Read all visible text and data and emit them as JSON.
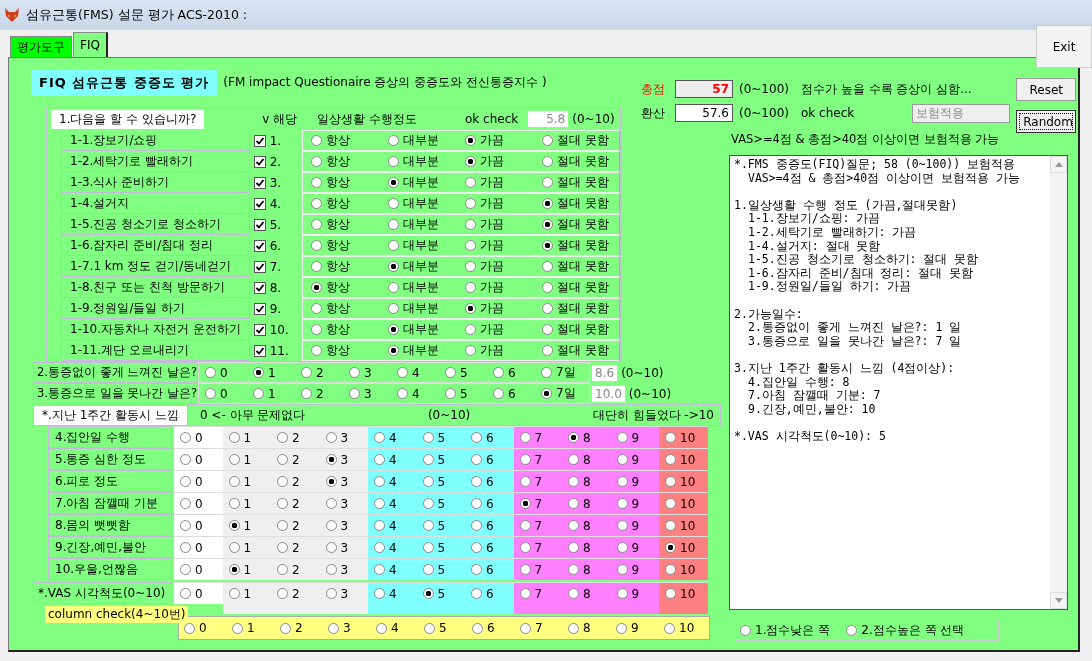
{
  "window": {
    "title": "섬유근통(FMS) 설문 평가 ACS-2010 :"
  },
  "tabs": [
    {
      "label": "평가도구",
      "selected": false
    },
    {
      "label": "FIQ",
      "selected": true
    }
  ],
  "exit_button": "Exit",
  "heading": {
    "title": "FIQ 섬유근통 중증도 평가",
    "subtitle": "(FM impact Questionaire 증상의 중증도와 전신통증지수 )"
  },
  "daily": {
    "title": "1.다음을 할 수 있습니까?",
    "check_header": "v 해당",
    "scale_header": "일상생활 수행정도",
    "ok_label": "ok check",
    "ok_value": "5.8",
    "range": "(0~10)",
    "items": [
      {
        "label": "1-1.장보기/쇼핑",
        "checked": true,
        "number": "1.",
        "options": [
          {
            "label": "항상",
            "selected": false
          },
          {
            "label": "대부분",
            "selected": false
          },
          {
            "label": "가끔",
            "selected": true
          },
          {
            "label": "절대 못함",
            "selected": false
          }
        ]
      },
      {
        "label": "1-2.세탁기로 빨래하기",
        "checked": true,
        "number": "2.",
        "options": [
          {
            "label": "항상",
            "selected": false
          },
          {
            "label": "대부분",
            "selected": false
          },
          {
            "label": "가끔",
            "selected": true
          },
          {
            "label": "절대 못함",
            "selected": false
          }
        ]
      },
      {
        "label": "1-3.식사 준비하기",
        "checked": true,
        "number": "3.",
        "options": [
          {
            "label": "항상",
            "selected": false
          },
          {
            "label": "대부분",
            "selected": true
          },
          {
            "label": "가끔",
            "selected": false
          },
          {
            "label": "절대 못함",
            "selected": false
          }
        ]
      },
      {
        "label": "1-4.설거지",
        "checked": true,
        "number": "4.",
        "options": [
          {
            "label": "항상",
            "selected": false
          },
          {
            "label": "대부분",
            "selected": false
          },
          {
            "label": "가끔",
            "selected": false
          },
          {
            "label": "절대 못함",
            "selected": true
          }
        ]
      },
      {
        "label": "1-5.진공 청소기로 청소하기",
        "checked": true,
        "number": "5.",
        "options": [
          {
            "label": "항상",
            "selected": false
          },
          {
            "label": "대부분",
            "selected": false
          },
          {
            "label": "가끔",
            "selected": false
          },
          {
            "label": "절대 못함",
            "selected": true
          }
        ]
      },
      {
        "label": "1-6.잠자리 준비/침대 정리",
        "checked": true,
        "number": "6.",
        "options": [
          {
            "label": "항상",
            "selected": false
          },
          {
            "label": "대부분",
            "selected": false
          },
          {
            "label": "가끔",
            "selected": false
          },
          {
            "label": "절대 못함",
            "selected": true
          }
        ]
      },
      {
        "label": "1-7.1 km 정도 걷기/동네걷기",
        "checked": true,
        "number": "7.",
        "options": [
          {
            "label": "항상",
            "selected": false
          },
          {
            "label": "대부분",
            "selected": true
          },
          {
            "label": "가끔",
            "selected": false
          },
          {
            "label": "절대 못함",
            "selected": false
          }
        ]
      },
      {
        "label": "1-8.친구 또는 친척 방문하기",
        "checked": true,
        "number": "8.",
        "options": [
          {
            "label": "항상",
            "selected": true
          },
          {
            "label": "대부분",
            "selected": false
          },
          {
            "label": "가끔",
            "selected": false
          },
          {
            "label": "절대 못함",
            "selected": false
          }
        ]
      },
      {
        "label": "1-9.정원일/들일 하기",
        "checked": true,
        "number": "9.",
        "options": [
          {
            "label": "항상",
            "selected": false
          },
          {
            "label": "대부분",
            "selected": false
          },
          {
            "label": "가끔",
            "selected": true
          },
          {
            "label": "절대 못함",
            "selected": false
          }
        ]
      },
      {
        "label": "1-10.자동차나 자전거 운전하기",
        "checked": true,
        "number": "10.",
        "options": [
          {
            "label": "항상",
            "selected": false
          },
          {
            "label": "대부분",
            "selected": true
          },
          {
            "label": "가끔",
            "selected": false
          },
          {
            "label": "절대 못함",
            "selected": false
          }
        ]
      },
      {
        "label": "1-11.계단 오르내리기",
        "checked": true,
        "number": "11.",
        "options": [
          {
            "label": "항상",
            "selected": false
          },
          {
            "label": "대부분",
            "selected": true
          },
          {
            "label": "가끔",
            "selected": false
          },
          {
            "label": "절대 못함",
            "selected": false
          }
        ]
      }
    ]
  },
  "days": [
    {
      "label": "2.통증없이 좋게 느껴진 날은?",
      "value": "8.6",
      "range": "(0~10)",
      "options": [
        {
          "label": "0",
          "selected": false
        },
        {
          "label": "1",
          "selected": true
        },
        {
          "label": "2",
          "selected": false
        },
        {
          "label": "3",
          "selected": false
        },
        {
          "label": "4",
          "selected": false
        },
        {
          "label": "5",
          "selected": false
        },
        {
          "label": "6",
          "selected": false
        },
        {
          "label": "7일",
          "selected": false
        }
      ]
    },
    {
      "label": "3.통증으로 일을 못나간 날은?",
      "value": "10.0",
      "range": "(0~10)",
      "options": [
        {
          "label": "0",
          "selected": false
        },
        {
          "label": "1",
          "selected": false
        },
        {
          "label": "2",
          "selected": false
        },
        {
          "label": "3",
          "selected": false
        },
        {
          "label": "4",
          "selected": false
        },
        {
          "label": "5",
          "selected": false
        },
        {
          "label": "6",
          "selected": false
        },
        {
          "label": "7일",
          "selected": true
        }
      ]
    }
  ],
  "feelings": {
    "title": "*.지난 1주간 활동시 느낌",
    "low_label": "0 <- 아무 문제없다",
    "range": "(0~10)",
    "high_label": "대단히 힘들었다 ->10",
    "rows": [
      {
        "label": "4.집안일 수행",
        "options": [
          {
            "label": "0",
            "selected": false
          },
          {
            "label": "1",
            "selected": false
          },
          {
            "label": "2",
            "selected": false
          },
          {
            "label": "3",
            "selected": false
          },
          {
            "label": "4",
            "selected": false
          },
          {
            "label": "5",
            "selected": false
          },
          {
            "label": "6",
            "selected": false
          },
          {
            "label": "7",
            "selected": false
          },
          {
            "label": "8",
            "selected": true
          },
          {
            "label": "9",
            "selected": false
          },
          {
            "label": "10",
            "selected": false
          }
        ]
      },
      {
        "label": "5.통증 심한 정도",
        "options": [
          {
            "label": "0",
            "selected": false
          },
          {
            "label": "1",
            "selected": false
          },
          {
            "label": "2",
            "selected": false
          },
          {
            "label": "3",
            "selected": true
          },
          {
            "label": "4",
            "selected": false
          },
          {
            "label": "5",
            "selected": false
          },
          {
            "label": "6",
            "selected": false
          },
          {
            "label": "7",
            "selected": false
          },
          {
            "label": "8",
            "selected": false
          },
          {
            "label": "9",
            "selected": false
          },
          {
            "label": "10",
            "selected": false
          }
        ]
      },
      {
        "label": "6.피로 정도",
        "options": [
          {
            "label": "0",
            "selected": false
          },
          {
            "label": "1",
            "selected": false
          },
          {
            "label": "2",
            "selected": false
          },
          {
            "label": "3",
            "selected": true
          },
          {
            "label": "4",
            "selected": false
          },
          {
            "label": "5",
            "selected": false
          },
          {
            "label": "6",
            "selected": false
          },
          {
            "label": "7",
            "selected": false
          },
          {
            "label": "8",
            "selected": false
          },
          {
            "label": "9",
            "selected": false
          },
          {
            "label": "10",
            "selected": false
          }
        ]
      },
      {
        "label": "7.아침 잠깰때 기분",
        "options": [
          {
            "label": "0",
            "selected": false
          },
          {
            "label": "1",
            "selected": false
          },
          {
            "label": "2",
            "selected": false
          },
          {
            "label": "3",
            "selected": false
          },
          {
            "label": "4",
            "selected": false
          },
          {
            "label": "5",
            "selected": false
          },
          {
            "label": "6",
            "selected": false
          },
          {
            "label": "7",
            "selected": true
          },
          {
            "label": "8",
            "selected": false
          },
          {
            "label": "9",
            "selected": false
          },
          {
            "label": "10",
            "selected": false
          }
        ]
      },
      {
        "label": "8.몸의 뻣뻣함",
        "options": [
          {
            "label": "0",
            "selected": false
          },
          {
            "label": "1",
            "selected": true
          },
          {
            "label": "2",
            "selected": false
          },
          {
            "label": "3",
            "selected": false
          },
          {
            "label": "4",
            "selected": false
          },
          {
            "label": "5",
            "selected": false
          },
          {
            "label": "6",
            "selected": false
          },
          {
            "label": "7",
            "selected": false
          },
          {
            "label": "8",
            "selected": false
          },
          {
            "label": "9",
            "selected": false
          },
          {
            "label": "10",
            "selected": false
          }
        ]
      },
      {
        "label": "9.긴장,예민,불안",
        "options": [
          {
            "label": "0",
            "selected": false
          },
          {
            "label": "1",
            "selected": false
          },
          {
            "label": "2",
            "selected": false
          },
          {
            "label": "3",
            "selected": false
          },
          {
            "label": "4",
            "selected": false
          },
          {
            "label": "5",
            "selected": false
          },
          {
            "label": "6",
            "selected": false
          },
          {
            "label": "7",
            "selected": false
          },
          {
            "label": "8",
            "selected": false
          },
          {
            "label": "9",
            "selected": false
          },
          {
            "label": "10",
            "selected": true
          }
        ]
      },
      {
        "label": "10.우울,언짢음",
        "options": [
          {
            "label": "0",
            "selected": false
          },
          {
            "label": "1",
            "selected": true
          },
          {
            "label": "2",
            "selected": false
          },
          {
            "label": "3",
            "selected": false
          },
          {
            "label": "4",
            "selected": false
          },
          {
            "label": "5",
            "selected": false
          },
          {
            "label": "6",
            "selected": false
          },
          {
            "label": "7",
            "selected": false
          },
          {
            "label": "8",
            "selected": false
          },
          {
            "label": "9",
            "selected": false
          },
          {
            "label": "10",
            "selected": false
          }
        ]
      }
    ]
  },
  "vas": {
    "label": "*.VAS 시각척도(0~10)",
    "options": [
      {
        "label": "0",
        "selected": false
      },
      {
        "label": "1",
        "selected": false
      },
      {
        "label": "2",
        "selected": false
      },
      {
        "label": "3",
        "selected": false
      },
      {
        "label": "4",
        "selected": false
      },
      {
        "label": "5",
        "selected": true
      },
      {
        "label": "6",
        "selected": false
      },
      {
        "label": "7",
        "selected": false
      },
      {
        "label": "8",
        "selected": false
      },
      {
        "label": "9",
        "selected": false
      },
      {
        "label": "10",
        "selected": false
      }
    ]
  },
  "column_check": {
    "label": "column check(4~10번)",
    "options": [
      {
        "label": "0",
        "selected": false
      },
      {
        "label": "1",
        "selected": false
      },
      {
        "label": "2",
        "selected": false
      },
      {
        "label": "3",
        "selected": false
      },
      {
        "label": "4",
        "selected": false
      },
      {
        "label": "5",
        "selected": false
      },
      {
        "label": "6",
        "selected": false
      },
      {
        "label": "7",
        "selected": false
      },
      {
        "label": "8",
        "selected": false
      },
      {
        "label": "9",
        "selected": false
      },
      {
        "label": "10",
        "selected": false
      }
    ]
  },
  "scores": {
    "total": {
      "label": "총점",
      "value": "57",
      "range": "(0~100)",
      "note": "점수가 높을 수록 증상이 심함..."
    },
    "converted": {
      "label": "환산",
      "value": "57.6",
      "range": "(0~100)",
      "ok_label": "ok check",
      "status": "보험적용"
    },
    "rule": "VAS>=4점 & 총점>40점 이상이면 보험적용 가능"
  },
  "buttons": [
    {
      "label": "Reset",
      "focused": false
    },
    {
      "label": "Random",
      "focused": true
    }
  ],
  "report": [
    {
      "title": "*.FMS 중증도(FIQ)질문; 58 (0~100)) 보험적용",
      "lines": [
        "VAS>=4점 & 총점>40점 이상이면 보험적용 가능"
      ]
    },
    {
      "title": "1.일상생활 수행 정도 (가끔,절대못함)",
      "lines": [
        "1-1.장보기/쇼핑: 가끔",
        "1-2.세탁기로 빨래하기: 가끔",
        "1-4.설거지: 절대 못함",
        "1-5.진공 청소기로 청소하기: 절대 못함",
        "1-6.잠자리 준비/침대 정리: 절대 못함",
        "1-9.정원일/들일 하기: 가끔"
      ]
    },
    {
      "title": "2.가능일수:",
      "lines": [
        "2.통증없이 좋게 느껴진 날은?: 1 일",
        "3.통증으로 일을 못나간 날은?: 7 일"
      ]
    },
    {
      "title": "3.지난 1주간 활동시 느낌 (4점이상):",
      "lines": [
        "4.집안일 수행: 8",
        "7.아침 잠깰때 기분: 7",
        "9.긴장,예민,불안: 10"
      ]
    },
    {
      "title": "*.VAS 시각척도(0~10): 5"
    }
  ],
  "score_side": [
    {
      "label": "1.점수낮은 쪽",
      "selected": false
    },
    {
      "label": "2.점수높은 쪽 선택",
      "selected": false
    }
  ]
}
